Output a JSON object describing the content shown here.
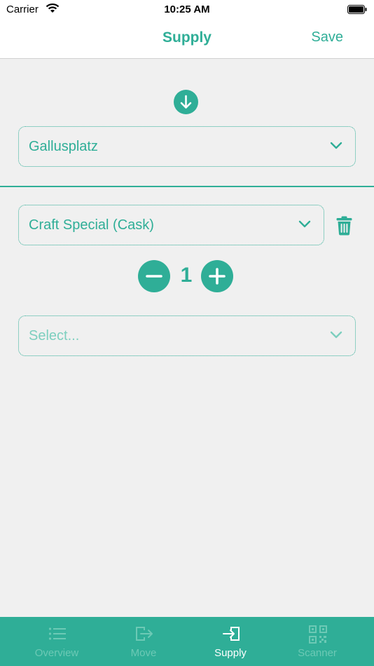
{
  "status_bar": {
    "carrier": "Carrier",
    "time": "10:25 AM"
  },
  "nav": {
    "title": "Supply",
    "save_label": "Save"
  },
  "location_select": {
    "value": "Gallusplatz"
  },
  "item_rows": [
    {
      "product": "Craft Special (Cask)",
      "quantity": "1"
    }
  ],
  "new_item_select": {
    "placeholder": "Select..."
  },
  "tabs": [
    {
      "label": "Overview",
      "icon": "list-icon",
      "active": false
    },
    {
      "label": "Move",
      "icon": "move-out-icon",
      "active": false
    },
    {
      "label": "Supply",
      "icon": "supply-in-icon",
      "active": true
    },
    {
      "label": "Scanner",
      "icon": "qr-code-icon",
      "active": false
    }
  ],
  "colors": {
    "accent": "#2fae97",
    "background": "#f0f0f0",
    "tab_inactive": "#6cc9b5"
  }
}
